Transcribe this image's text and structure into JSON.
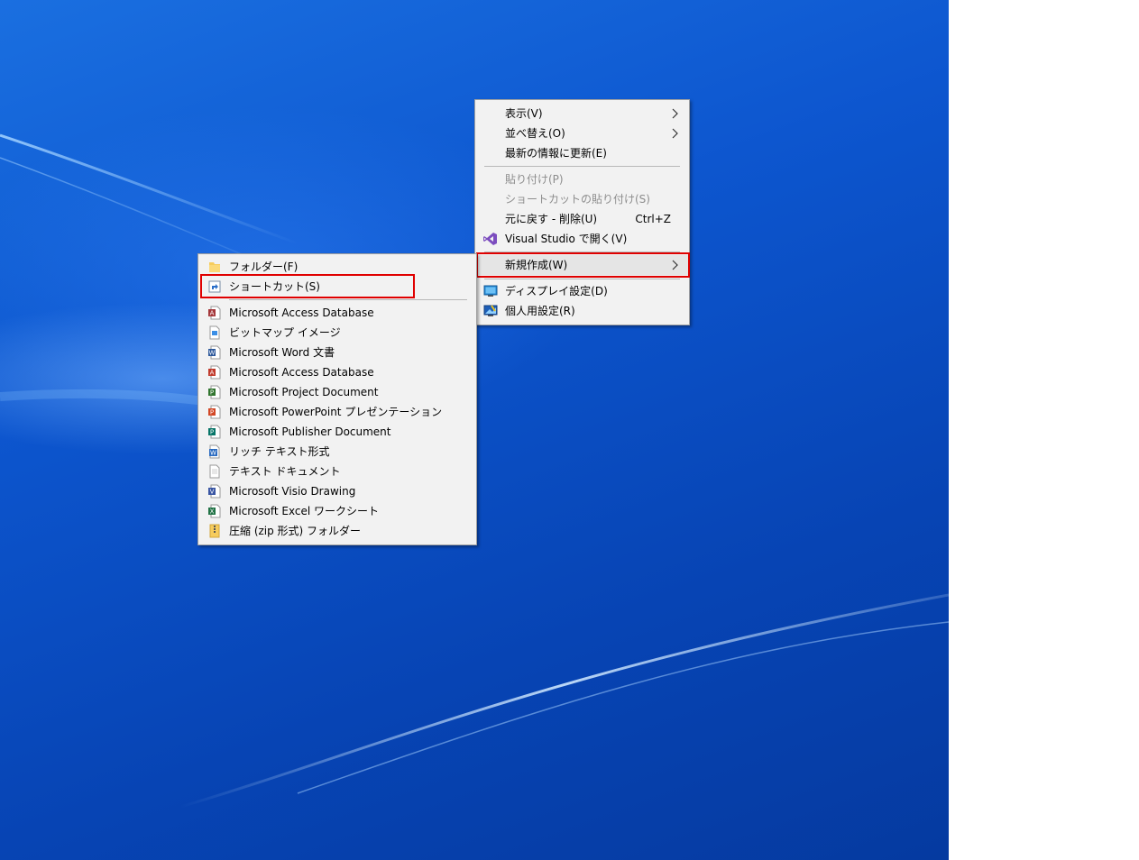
{
  "main_menu": {
    "items": [
      {
        "label": "表示(V)",
        "has_submenu": true,
        "enabled": true
      },
      {
        "label": "並べ替え(O)",
        "has_submenu": true,
        "enabled": true
      },
      {
        "label": "最新の情報に更新(E)",
        "enabled": true
      },
      {
        "label": "貼り付け(P)",
        "enabled": false
      },
      {
        "label": "ショートカットの貼り付け(S)",
        "enabled": false
      },
      {
        "label": "元に戻す - 削除(U)",
        "shortcut": "Ctrl+Z",
        "enabled": true
      },
      {
        "label": "Visual Studio で開く(V)",
        "icon": "visual-studio-icon",
        "enabled": true
      },
      {
        "label": "新規作成(W)",
        "has_submenu": true,
        "enabled": true,
        "highlighted": true
      },
      {
        "label": "ディスプレイ設定(D)",
        "icon": "display-settings-icon",
        "enabled": true
      },
      {
        "label": "個人用設定(R)",
        "icon": "personalize-icon",
        "enabled": true
      }
    ]
  },
  "new_submenu": {
    "items": [
      {
        "label": "フォルダー(F)",
        "icon": "folder-icon"
      },
      {
        "label": "ショートカット(S)",
        "icon": "shortcut-icon",
        "highlighted": true
      },
      {
        "label": "Microsoft Access Database",
        "icon": "access-file-icon"
      },
      {
        "label": "ビットマップ イメージ",
        "icon": "bitmap-file-icon"
      },
      {
        "label": "Microsoft Word 文書",
        "icon": "word-file-icon"
      },
      {
        "label": "Microsoft Access Database",
        "icon": "access-file-icon"
      },
      {
        "label": "Microsoft Project Document",
        "icon": "project-file-icon"
      },
      {
        "label": "Microsoft PowerPoint プレゼンテーション",
        "icon": "powerpoint-file-icon"
      },
      {
        "label": "Microsoft Publisher Document",
        "icon": "publisher-file-icon"
      },
      {
        "label": "リッチ テキスト形式",
        "icon": "rtf-file-icon"
      },
      {
        "label": "テキスト ドキュメント",
        "icon": "text-file-icon"
      },
      {
        "label": "Microsoft Visio Drawing",
        "icon": "visio-file-icon"
      },
      {
        "label": "Microsoft Excel ワークシート",
        "icon": "excel-file-icon"
      },
      {
        "label": "圧縮 (zip 形式) フォルダー",
        "icon": "zip-folder-icon"
      }
    ]
  },
  "colors": {
    "highlight_border": "#e00000",
    "desktop_blue": "#0d56cf",
    "menu_bg": "#f2f2f2"
  }
}
